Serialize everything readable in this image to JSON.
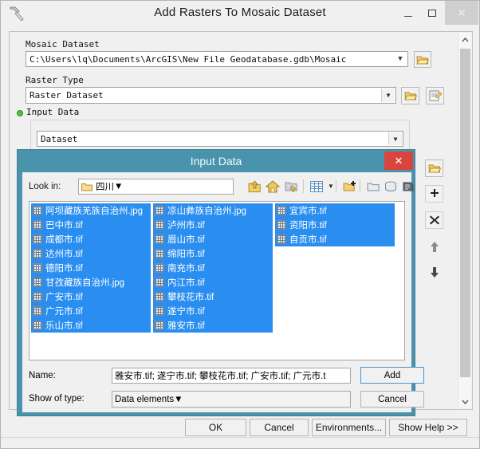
{
  "window": {
    "title": "Add Rasters To Mosaic Dataset",
    "icon": "hammer-tool-icon",
    "minimize": "–",
    "maximize": "❐",
    "close": "✕"
  },
  "form": {
    "mosaic_dataset_label": "Mosaic Dataset",
    "mosaic_dataset_value": "C:\\Users\\lq\\Documents\\ArcGIS\\New File Geodatabase.gdb\\Mosaic",
    "raster_type_label": "Raster Type",
    "raster_type_value": "Raster Dataset",
    "input_data_label": "Input Data",
    "input_data_mode": "Dataset",
    "browse_icon": "open-folder-icon",
    "properties_icon": "raster-properties-icon",
    "add_row_icon": "plus-icon",
    "remove_row_icon": "x-icon",
    "move_up_icon": "arrow-up-icon",
    "move_down_icon": "arrow-down-icon",
    "scroll_up_icon": "chevron-up-icon",
    "scroll_down_icon": "chevron-down-icon"
  },
  "footer": {
    "ok": "OK",
    "cancel": "Cancel",
    "environments": "Environments...",
    "show_help": "Show Help >>"
  },
  "dialog": {
    "title": "Input Data",
    "close": "✕",
    "look_in_label": "Look in:",
    "look_in_value": "四川",
    "toolbar": [
      {
        "name": "up-one-level-icon",
        "glyph": "⬆"
      },
      {
        "name": "home-folder-icon",
        "glyph": "⌂"
      },
      {
        "name": "go-to-folder-icon",
        "glyph": "▤"
      },
      {
        "name": "view-details-icon",
        "glyph": "▦"
      },
      {
        "name": "view-dropdown-icon",
        "glyph": "▾"
      },
      {
        "name": "new-folder-connection-icon",
        "glyph": "▣"
      },
      {
        "name": "folder-connection-icon",
        "glyph": "▭"
      },
      {
        "name": "database-connection-icon",
        "glyph": "◧"
      },
      {
        "name": "server-connection-icon",
        "glyph": "◩"
      }
    ],
    "files": [
      [
        {
          "label": "阿坝藏族羌族自治州.jpg",
          "selected": true
        },
        {
          "label": "巴中市.tif",
          "selected": true
        },
        {
          "label": "成都市.tif",
          "selected": true
        },
        {
          "label": "达州市.tif",
          "selected": true
        },
        {
          "label": "德阳市.tif",
          "selected": true
        },
        {
          "label": "甘孜藏族自治州.jpg",
          "selected": true
        },
        {
          "label": "广安市.tif",
          "selected": true
        },
        {
          "label": "广元市.tif",
          "selected": true
        },
        {
          "label": "乐山市.tif",
          "selected": true
        }
      ],
      [
        {
          "label": "凉山彝族自治州.jpg",
          "selected": true
        },
        {
          "label": "泸州市.tif",
          "selected": true
        },
        {
          "label": "眉山市.tif",
          "selected": true
        },
        {
          "label": "绵阳市.tif",
          "selected": true
        },
        {
          "label": "南充市.tif",
          "selected": true
        },
        {
          "label": "内江市.tif",
          "selected": true
        },
        {
          "label": "攀枝花市.tif",
          "selected": true
        },
        {
          "label": "遂宁市.tif",
          "selected": true
        },
        {
          "label": "雅安市.tif",
          "selected": true
        }
      ],
      [
        {
          "label": "宜宾市.tif",
          "selected": true
        },
        {
          "label": "资阳市.tif",
          "selected": true
        },
        {
          "label": "自贡市.tif",
          "selected": true
        }
      ]
    ],
    "name_label": "Name:",
    "name_value": "雅安市.tif; 遂宁市.tif; 攀枝花市.tif; 广安市.tif; 广元市.t",
    "show_type_label": "Show of type:",
    "show_type_value": "Data elements",
    "add_button": "Add",
    "cancel_button": "Cancel"
  },
  "colors": {
    "dialog_title_bg": "#4a93ad",
    "selection_blue": "#2a8ef0",
    "close_red": "#d9453d",
    "window_bg": "#f0f0f0",
    "green_dot": "#46c832"
  }
}
